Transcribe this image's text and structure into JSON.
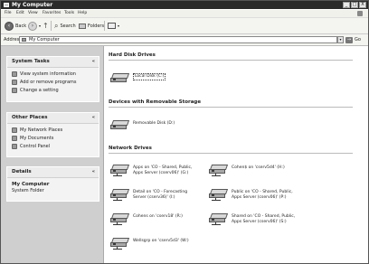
{
  "window": {
    "title": "My Computer",
    "controls": [
      "_",
      "□",
      "X"
    ]
  },
  "menu": [
    "File",
    "Edit",
    "View",
    "Favorites",
    "Tools",
    "Help"
  ],
  "toolbar": {
    "back": "Back",
    "search": "Search",
    "folders": "Folders"
  },
  "address": {
    "label": "Address",
    "value": "My Computer",
    "go": "Go"
  },
  "left": {
    "system_tasks": {
      "title": "System Tasks",
      "items": [
        "View system information",
        "Add or remove programs",
        "Change a setting"
      ]
    },
    "other_places": {
      "title": "Other Places",
      "items": [
        "My Network Places",
        "My Documents",
        "Control Panel"
      ]
    },
    "details": {
      "title": "Details",
      "name": "My Computer",
      "sub": "System Folder"
    }
  },
  "content": {
    "hard_disk": {
      "title": "Hard Disk Drives",
      "items": [
        "Local Disk (C:)"
      ]
    },
    "removable": {
      "title": "Devices with Removable Storage",
      "items": [
        "Removable Disk (D:)"
      ]
    },
    "network": {
      "title": "Network Drives",
      "items": [
        {
          "line1": "Apps on 'CO - Shared, Public,",
          "line2": "Apps Server (cserv06)' (G:)"
        },
        {
          "line1": "Cohen$ on 'cserv5d4' (H:)",
          "line2": ""
        },
        {
          "line1": "Detail on 'CO - Forecasting",
          "line2": "Server (cserv36)' (I:)"
        },
        {
          "line1": "Public on 'CO - Shared, Public,",
          "line2": "Apps Server (cserv06)' (P:)"
        },
        {
          "line1": "Cohens on 'cserv18' (R:)",
          "line2": ""
        },
        {
          "line1": "Shared on 'CO - Shared, Public,",
          "line2": "Apps Server (cserv06)' (S:)"
        },
        {
          "line1": "Wellsgrp on 'cserv5d3' (W:)",
          "line2": ""
        }
      ]
    }
  }
}
